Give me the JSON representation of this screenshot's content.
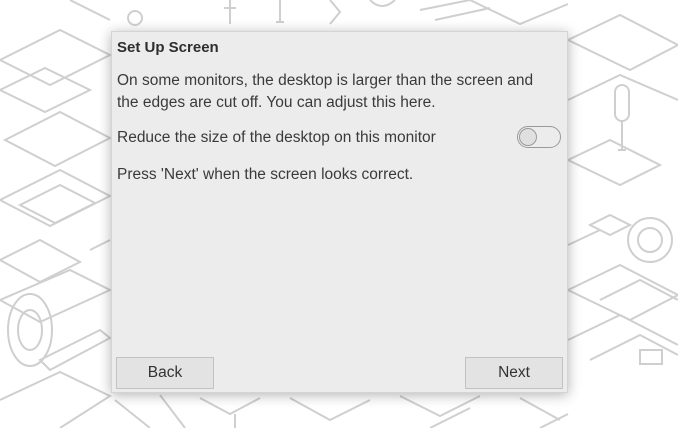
{
  "dialog": {
    "title": "Set Up Screen",
    "description": "On some monitors, the desktop is larger than the screen and the edges are cut off. You can adjust this here.",
    "setting": {
      "label": "Reduce the size of the desktop on this monitor",
      "enabled": false
    },
    "hint": "Press 'Next' when the screen looks correct.",
    "back_label": "Back",
    "next_label": "Next"
  },
  "wallpaper": {
    "icon": "outline-hardware-pattern",
    "line_color": "#cfcfcf"
  }
}
